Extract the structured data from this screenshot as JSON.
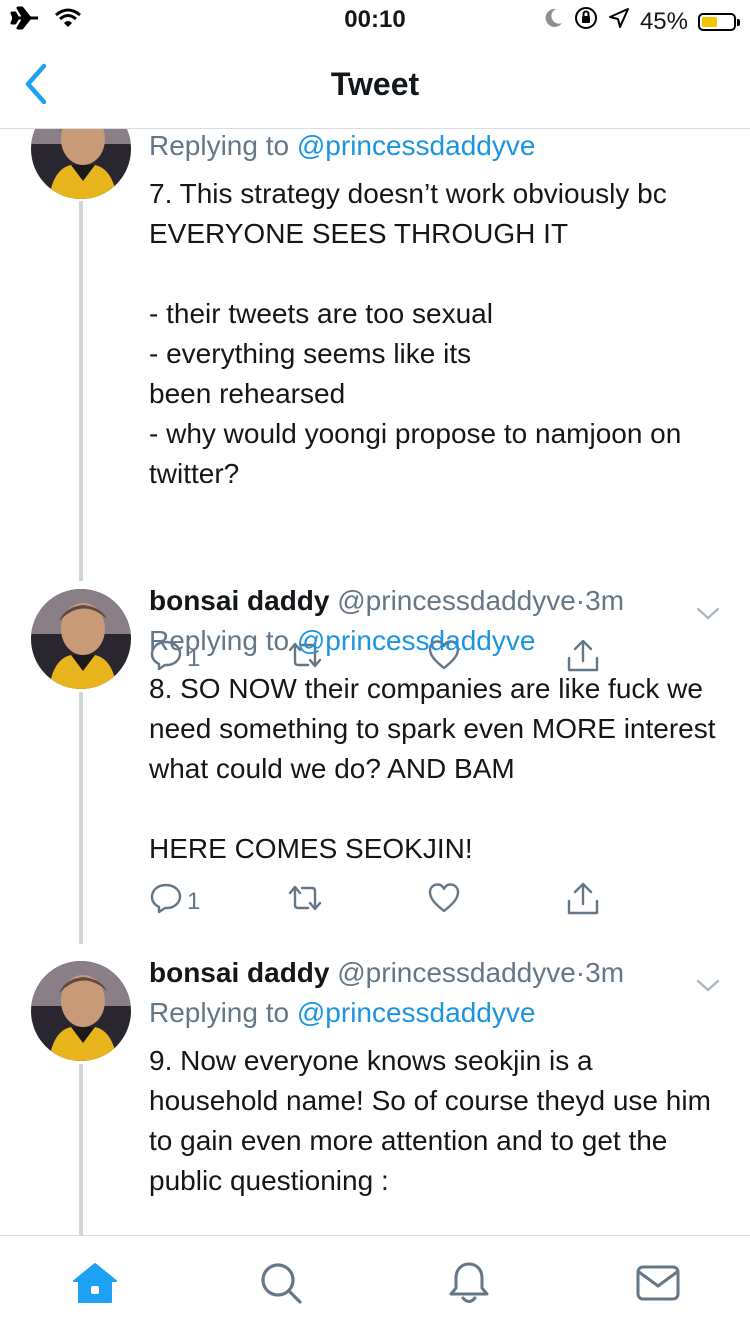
{
  "status_bar": {
    "time": "00:10",
    "battery": "45%",
    "battery_level": 0.45
  },
  "nav": {
    "title": "Tweet"
  },
  "tweets": [
    {
      "name": "",
      "handle": "",
      "time": "",
      "reply_prefix": "Replying to ",
      "reply_handle": "@princessdaddyve",
      "text": "7. This strategy doesn’t work obviously bc EVERYONE SEES THROUGH IT\n\n- their tweets are too sexual\n- everything seems like its\nbeen rehearsed\n- why would yoongi propose to namjoon on twitter?",
      "reply_count": "1"
    },
    {
      "name": "bonsai daddy",
      "handle": "@princessdaddyve",
      "time": "3m",
      "reply_prefix": "Replying to ",
      "reply_handle": "@princessdaddyve",
      "text": "8. SO NOW their companies are like fuck we need something to spark even MORE interest what could we do? AND BAM\n\nHERE COMES SEOKJIN!",
      "reply_count": "1"
    },
    {
      "name": "bonsai daddy",
      "handle": "@princessdaddyve",
      "time": "3m",
      "reply_prefix": "Replying to ",
      "reply_handle": "@princessdaddyve",
      "text": "9. Now everyone knows seokjin is a household name! So of course theyd use him to gain even more attention and to get the public questioning :",
      "reply_count": ""
    }
  ],
  "separator": "·",
  "colors": {
    "accent": "#1da1f2",
    "reply_link": "#1b95e0",
    "muted": "#657786"
  },
  "tabs": [
    "home-icon",
    "search-icon",
    "notifications-icon",
    "messages-icon"
  ]
}
